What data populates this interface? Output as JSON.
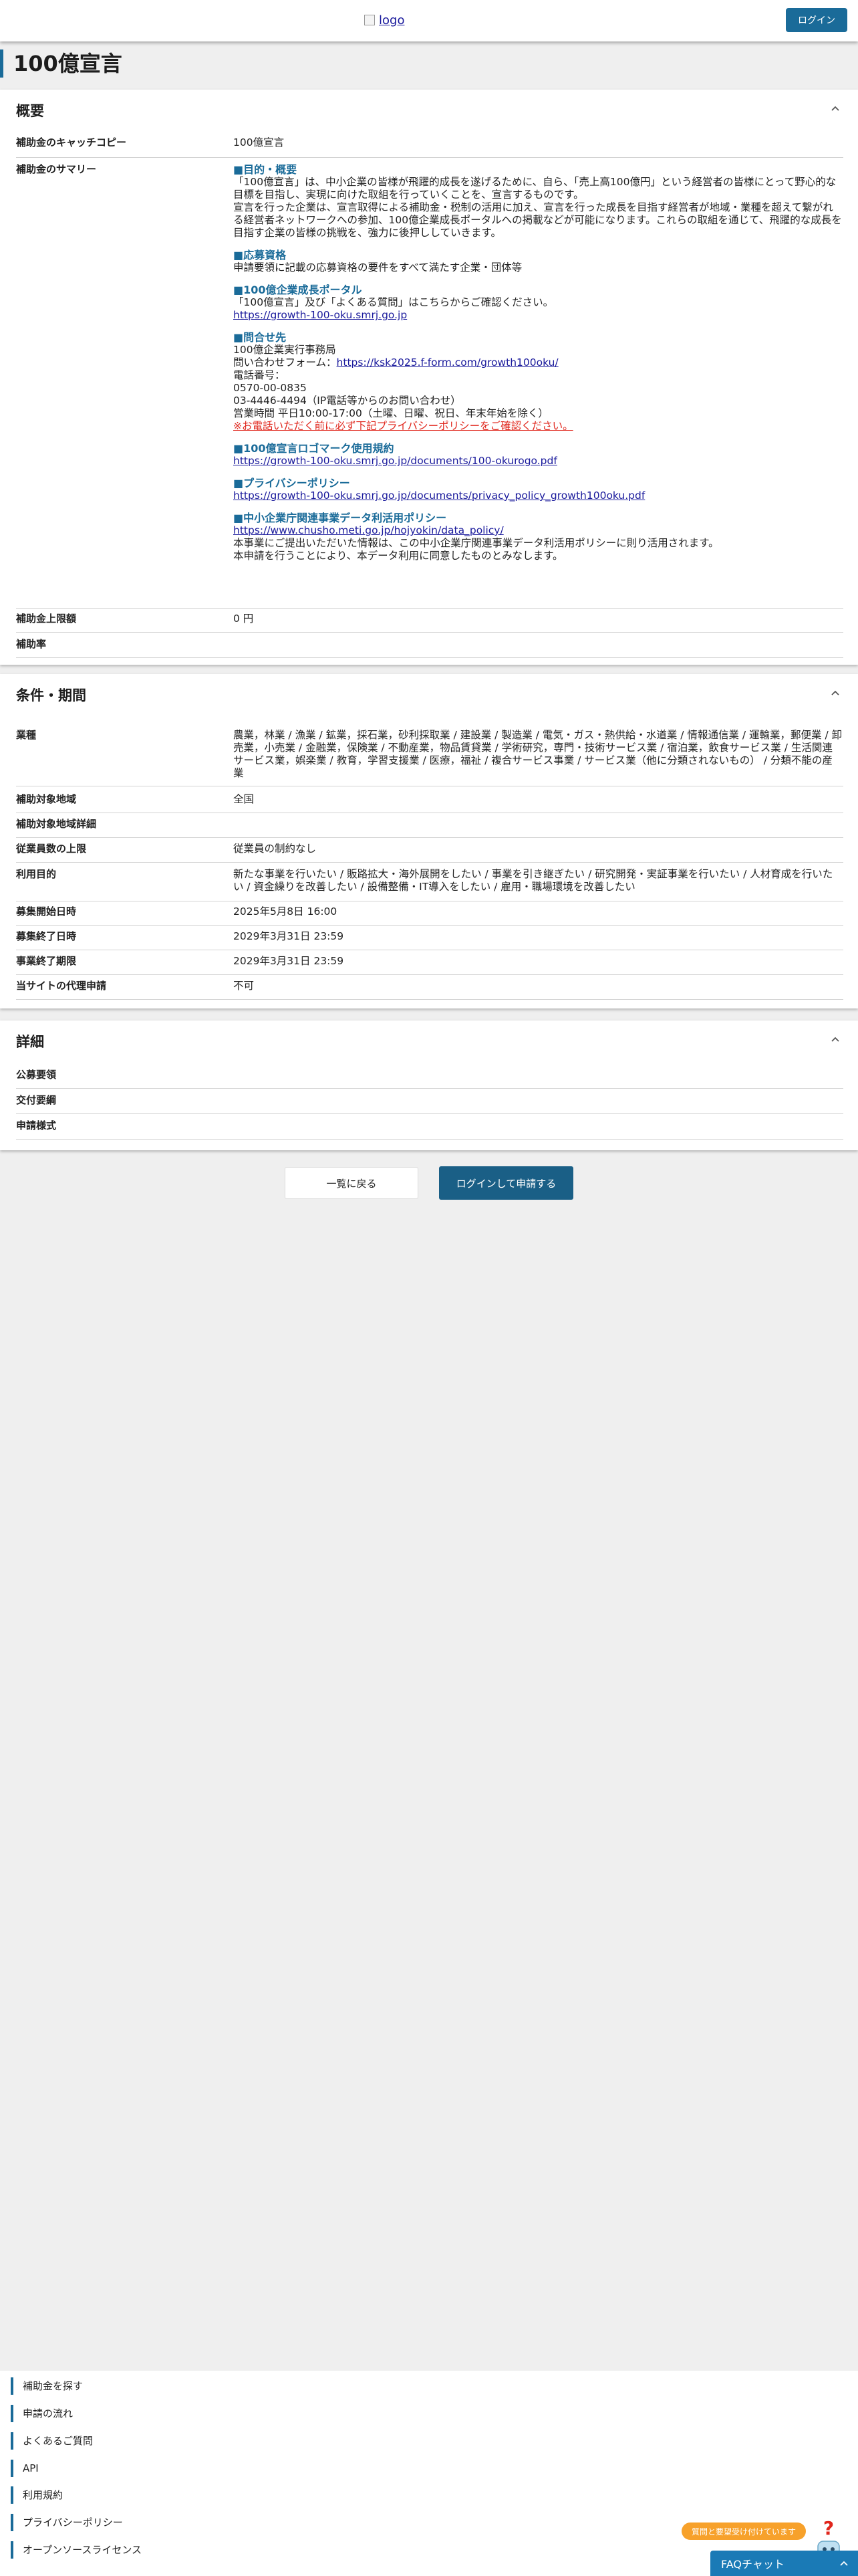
{
  "header": {
    "logo_alt": "logo",
    "login_label": "ログイン"
  },
  "page_title": "100億宣言",
  "overview": {
    "title": "概要",
    "catchcopy_label": "補助金のキャッチコピー",
    "catchcopy_value": "100億宣言",
    "summary_label": "補助金のサマリー",
    "summary": {
      "purpose_head": "■目的・概要",
      "purpose_body": "「100億宣言」は、中小企業の皆様が飛躍的成長を遂げるために、自ら、「売上高100億円」という経営者の皆様にとって野心的な目標を目指し、実現に向けた取組を行っていくことを、宣言するものです。",
      "purpose_body2": "宣言を行った企業は、宣言取得による補助金・税制の活用に加え、宣言を行った成長を目指す経営者が地域・業種を超えて繋がれる経営者ネットワークへの参加、100億企業成長ポータルへの掲載などが可能になります。これらの取組を通じて、飛躍的な成長を目指す企業の皆様の挑戦を、強力に後押ししていきます。",
      "eligibility_head": "■応募資格",
      "eligibility_body": "申請要領に記載の応募資格の要件をすべて満たす企業・団体等",
      "portal_head": "■100億企業成長ポータル",
      "portal_body": "「100億宣言」及び「よくある質問」はこちらからご確認ください。",
      "portal_link": "https://growth-100-oku.smrj.go.jp",
      "contact_head": "■問合せ先",
      "contact_org": "100億企業実行事務局",
      "contact_form_label": "問い合わせフォーム：",
      "contact_form_link": "https://ksk2025.f-form.com/growth100oku/",
      "contact_tel_label": "電話番号：",
      "contact_tel1": "0570-00-0835",
      "contact_tel2": "03-4446-4494（IP電話等からのお問い合わせ）",
      "contact_hours": "営業時間 平日10:00-17:00（土曜、日曜、祝日、年末年始を除く）",
      "contact_warning": "※お電話いただく前に必ず下記プライバシーポリシーをご確認ください。",
      "logo_terms_head": "■100億宣言ロゴマーク使用規約",
      "logo_terms_link": "https://growth-100-oku.smrj.go.jp/documents/100-okurogo.pdf",
      "privacy_head": "■プライバシーポリシー",
      "privacy_link": "https://growth-100-oku.smrj.go.jp/documents/privacy_policy_growth100oku.pdf",
      "data_head": "■中小企業庁関連事業データ利活用ポリシー",
      "data_link": "https://www.chusho.meti.go.jp/hojyokin/data_policy/",
      "data_body1": "本事業にご提出いただいた情報は、この中小企業庁関連事業データ利活用ポリシーに則り活用されます。",
      "data_body2": "本申請を行うことにより、本データ利用に同意したものとみなします。"
    },
    "max_amount_label": "補助金上限額",
    "max_amount_value": "0 円",
    "rate_label": "補助率",
    "rate_value": ""
  },
  "conditions": {
    "title": "条件・期間",
    "industry_label": "業種",
    "industry_value": "農業，林業 / 漁業 / 鉱業，採石業，砂利採取業 / 建設業 / 製造業 / 電気・ガス・熱供給・水道業 / 情報通信業 / 運輸業，郵便業 / 卸売業，小売業 / 金融業，保険業 / 不動産業，物品賃貸業 / 学術研究，専門・技術サービス業 / 宿泊業，飲食サービス業 / 生活関連サービス業，娯楽業 / 教育，学習支援業 / 医療，福祉 / 複合サービス事業 / サービス業（他に分類されないもの） / 分類不能の産業",
    "region_label": "補助対象地域",
    "region_value": "全国",
    "region_detail_label": "補助対象地域詳細",
    "region_detail_value": "",
    "employees_label": "従業員数の上限",
    "employees_value": "従業員の制約なし",
    "purpose_label": "利用目的",
    "purpose_value": "新たな事業を行いたい / 販路拡大・海外展開をしたい / 事業を引き継ぎたい / 研究開発・実証事業を行いたい / 人材育成を行いたい / 資金繰りを改善したい / 設備整備・IT導入をしたい / 雇用・職場環境を改善したい",
    "start_label": "募集開始日時",
    "start_value": "2025年5月8日 16:00",
    "end_label": "募集終了日時",
    "end_value": "2029年3月31日 23:59",
    "project_end_label": "事業終了期限",
    "project_end_value": "2029年3月31日 23:59",
    "proxy_label": "当サイトの代理申請",
    "proxy_value": "不可"
  },
  "details": {
    "title": "詳細",
    "row1": "公募要領",
    "row2": "交付要綱",
    "row3": "申請様式"
  },
  "actions": {
    "back_label": "一覧に戻る",
    "apply_label": "ログインして申請する"
  },
  "footer": {
    "links": [
      "補助金を探す",
      "申請の流れ",
      "よくあるご質問",
      "API",
      "利用規約",
      "プライバシーポリシー",
      "オープンソースライセンス"
    ]
  },
  "widget": {
    "badge_label": "質問と要望受け付けています",
    "faq_label": "FAQチャット"
  },
  "colors": {
    "accent": "#1a6b99",
    "warning": "#e0261c",
    "badge": "#f7a12b"
  }
}
